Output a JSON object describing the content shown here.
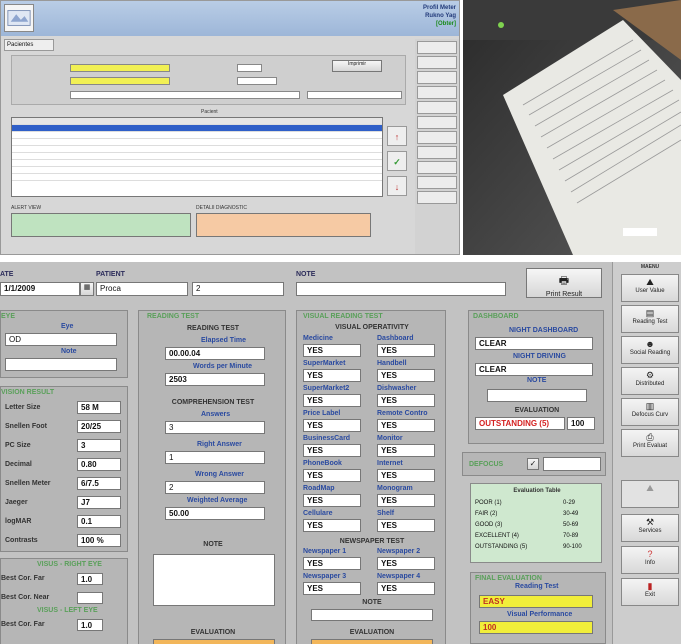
{
  "mini_app": {
    "top_links": [
      "Profil Meter",
      "Rukno Yag",
      "[Obter]"
    ],
    "tab": "Pacientes",
    "print_button": "Imprimir",
    "grid_header": "Pacient",
    "footer_left": "ALERT VIEW",
    "footer_right": "DETALII DIAGNOSTIC"
  },
  "header": {
    "date_label": "ATE",
    "date_value": "1/1/2009",
    "patient_label": "PATIENT",
    "patient_value": "Proca",
    "patient_id": "2",
    "note_label": "NOTE",
    "print_button": "Print Result"
  },
  "sidebar": {
    "title": "MAENU",
    "items": [
      {
        "label": "User Value",
        "icon": "mountain-icon"
      },
      {
        "label": "Reading Test",
        "icon": "book-icon"
      },
      {
        "label": "Social Reading",
        "icon": "people-icon"
      },
      {
        "label": "Distributed",
        "icon": "gear-icon"
      },
      {
        "label": "Defocus Curv",
        "icon": "chart-icon"
      },
      {
        "label": "Print Evaluat",
        "icon": "printer-icon"
      },
      {
        "label": "Services",
        "icon": "tools-icon"
      },
      {
        "label": "Info",
        "icon": "question-icon"
      },
      {
        "label": "Exit",
        "icon": "exit-icon"
      }
    ]
  },
  "eye": {
    "title": "EYE",
    "eye_label": "Eye",
    "eye_value": "OD",
    "note_label": "Note"
  },
  "vision_result": {
    "title": "VISION RESULT",
    "rows": [
      {
        "label": "Letter Size",
        "value": "58 M"
      },
      {
        "label": "Snellen Foot",
        "value": "20/25"
      },
      {
        "label": "PC Size",
        "value": "3"
      },
      {
        "label": "Decimal",
        "value": "0.80"
      },
      {
        "label": "Snellen Meter",
        "value": "6/7.5"
      },
      {
        "label": "Jaeger",
        "value": "J7"
      },
      {
        "label": "logMAR",
        "value": "0.1"
      },
      {
        "label": "Contrasts",
        "value": "100 %"
      }
    ]
  },
  "vision_near": {
    "title": "VISUS - RIGHT EYE",
    "rows": [
      {
        "label": "Best Cor. Far",
        "value": "1.0"
      },
      {
        "label": "Best Cor. Near",
        "value": ""
      }
    ],
    "title2": "VISUS - LEFT EYE",
    "rows2": [
      {
        "label": "Best Cor. Far",
        "value": "1.0"
      }
    ]
  },
  "reading_test": {
    "title": "READING TEST",
    "heading": "READING TEST",
    "elapsed_label": "Elapsed Time",
    "elapsed_value": "00.00.04",
    "wpm_label": "Words per Minute",
    "wpm_value": "2503",
    "comp_heading": "COMPREHENSION TEST",
    "answers_label": "Answers",
    "answers_value": "3",
    "right_label": "Right Answer",
    "right_value": "1",
    "wrong_label": "Wrong Answer",
    "wrong_value": "2",
    "weighted_label": "Weighted Average",
    "weighted_value": "50.00",
    "note_label": "NOTE",
    "eval_label": "EVALUATION"
  },
  "visual_reading": {
    "title": "VISUAL READING TEST",
    "heading": "VISUAL OPERATIVITY",
    "pairs": [
      {
        "l": "Medicine",
        "lv": "YES",
        "r": "Dashboard",
        "rv": "YES"
      },
      {
        "l": "SuperMarket",
        "lv": "YES",
        "r": "Handbell",
        "rv": "YES"
      },
      {
        "l": "SuperMarket2",
        "lv": "YES",
        "r": "Dishwasher",
        "rv": "YES"
      },
      {
        "l": "Price Label",
        "lv": "YES",
        "r": "Remote Contro",
        "rv": "YES"
      },
      {
        "l": "BusinessCard",
        "lv": "YES",
        "r": "Monitor",
        "rv": "YES"
      },
      {
        "l": "PhoneBook",
        "lv": "YES",
        "r": "Internet",
        "rv": "YES"
      },
      {
        "l": "RoadMap",
        "lv": "YES",
        "r": "Monogram",
        "rv": "YES"
      },
      {
        "l": "Cellulare",
        "lv": "YES",
        "r": "Shelf",
        "rv": "YES"
      }
    ],
    "news_heading": "NEWSPAPER TEST",
    "news": [
      {
        "l": "Newspaper 1",
        "lv": "YES",
        "r": "Newspaper 2",
        "rv": "YES"
      },
      {
        "l": "Newspaper 3",
        "lv": "YES",
        "r": "Newspaper 4",
        "rv": "YES"
      }
    ],
    "note_label": "NOTE",
    "eval_label": "EVALUATION"
  },
  "dashboard": {
    "title": "DASHBOARD",
    "night_dash_label": "NIGHT DASHBOARD",
    "night_dash_value": "CLEAR",
    "night_drive_label": "NIGHT DRIVING",
    "night_drive_value": "CLEAR",
    "note_label": "NOTE",
    "eval_label": "EVALUATION",
    "eval_value": "OUTSTANDING (5)",
    "eval_score": "100"
  },
  "defocus": {
    "label": "DEFOCUS"
  },
  "eval_table": {
    "title": "Evaluation Table",
    "rows": [
      {
        "grade": "POOR (1)",
        "range": "0-29"
      },
      {
        "grade": "FAIR (2)",
        "range": "30-49"
      },
      {
        "grade": "GOOD (3)",
        "range": "50-69"
      },
      {
        "grade": "EXCELLENT (4)",
        "range": "70-89"
      },
      {
        "grade": "OUTSTANDING (5)",
        "range": "90-100"
      }
    ]
  },
  "final_eval": {
    "title": "FINAL EVALUATION",
    "reading_label": "Reading Test",
    "reading_value": "EASY",
    "visual_label": "Visual Performance",
    "visual_value": "100",
    "colors": {
      "yellow": "#f1ee3a",
      "orange": "#f2b65a"
    }
  }
}
